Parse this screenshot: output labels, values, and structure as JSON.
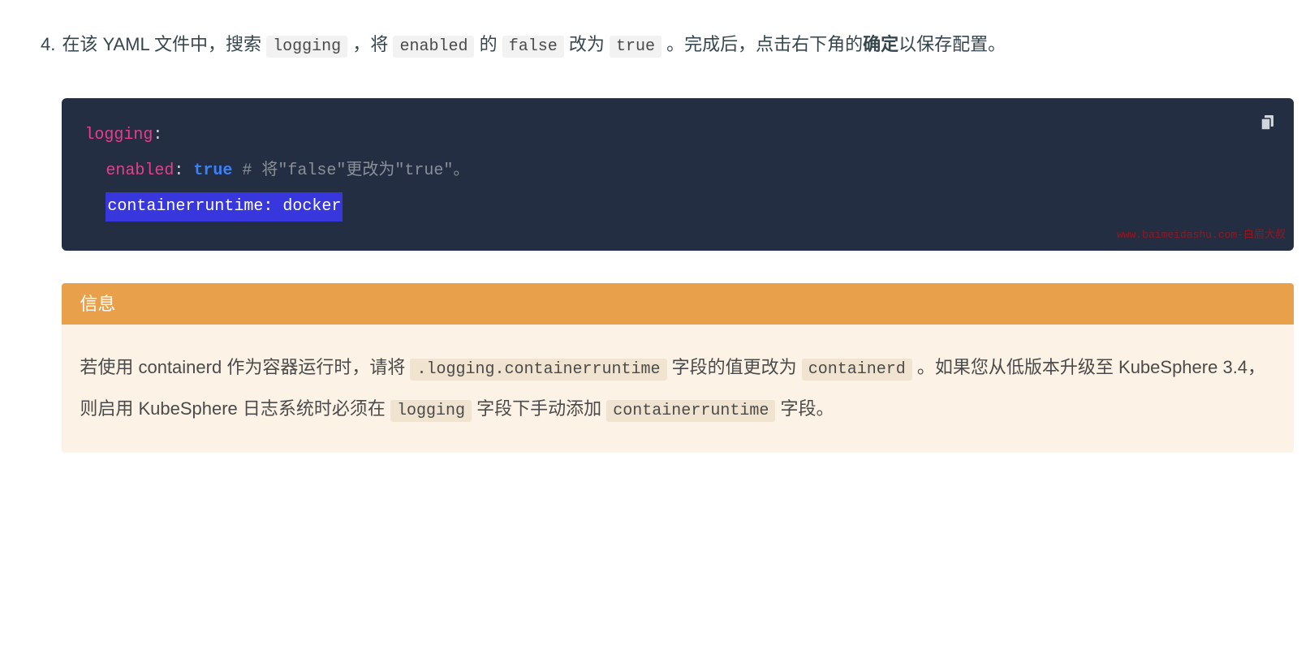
{
  "list_number": "4.",
  "instruction": {
    "part1": "在该 YAML 文件中，搜索 ",
    "code1": "logging",
    "part2": "，将 ",
    "code2": "enabled",
    "part3": " 的 ",
    "code3": "false",
    "part4": " 改为 ",
    "code4": "true",
    "part5": "。完成后，点击右下角的",
    "bold": "确定",
    "part6": "以保存配置。"
  },
  "code_block": {
    "line1_key": "logging",
    "line1_colon": ":",
    "line2_key": "enabled",
    "line2_colon": ": ",
    "line2_value": "true",
    "line2_comment": " # 将\"false\"更改为\"true\"。",
    "line3_key": "containerruntime",
    "line3_colon": ": ",
    "line3_value": "docker"
  },
  "watermark": "www.baimeidashu.com-白眉大叔",
  "info": {
    "title": "信息",
    "body_part1": "若使用 containerd 作为容器运行时，请将 ",
    "body_code1": ".logging.containerruntime",
    "body_part2": " 字段的值更改为 ",
    "body_code2": "containerd",
    "body_part3": "。如果您从低版本升级至 KubeSphere 3.4，则启用 KubeSphere 日志系统时必须在 ",
    "body_code3": "logging",
    "body_part4": " 字段下手动添加 ",
    "body_code4": "containerruntime",
    "body_part5": " 字段。"
  }
}
